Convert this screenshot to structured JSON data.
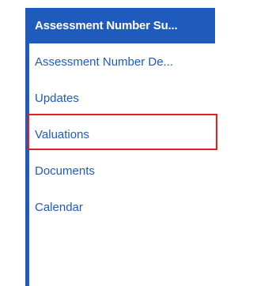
{
  "nav": {
    "accent_color": "#1f5bbd",
    "items": [
      {
        "label": "Assessment Number Su...",
        "active": true
      },
      {
        "label": "Assessment Number De...",
        "active": false
      },
      {
        "label": "Updates",
        "active": false
      },
      {
        "label": "Valuations",
        "active": false,
        "highlighted": true
      },
      {
        "label": "Documents",
        "active": false
      },
      {
        "label": "Calendar",
        "active": false
      }
    ]
  },
  "highlight_color": "#e02020"
}
